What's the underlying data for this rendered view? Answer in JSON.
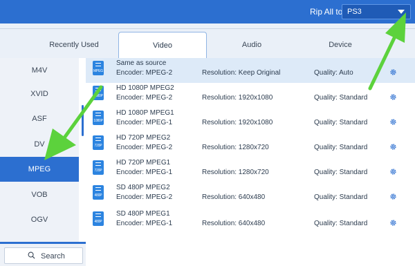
{
  "topbar": {
    "rip_label": "Rip All to:",
    "rip_value": "PS3"
  },
  "tabs": [
    {
      "label": "Recently Used",
      "active": false
    },
    {
      "label": "Video",
      "active": true
    },
    {
      "label": "Audio",
      "active": false
    },
    {
      "label": "Device",
      "active": false
    }
  ],
  "sidebar": {
    "items": [
      {
        "label": "M4V",
        "active": false
      },
      {
        "label": "XVID",
        "active": false
      },
      {
        "label": "ASF",
        "active": false
      },
      {
        "label": "DV",
        "active": false
      },
      {
        "label": "MPEG",
        "active": true
      },
      {
        "label": "VOB",
        "active": false
      },
      {
        "label": "OGV",
        "active": false
      }
    ],
    "search_label": "Search"
  },
  "formats": [
    {
      "tag": "MPEG",
      "name": "Same as source",
      "encoder": "Encoder: MPEG-2",
      "resolution": "Resolution: Keep Original",
      "quality": "Quality: Auto",
      "selected": true
    },
    {
      "tag": "1080P",
      "name": "HD 1080P MPEG2",
      "encoder": "Encoder: MPEG-2",
      "resolution": "Resolution: 1920x1080",
      "quality": "Quality: Standard",
      "selected": false
    },
    {
      "tag": "1080P",
      "name": "HD 1080P MPEG1",
      "encoder": "Encoder: MPEG-1",
      "resolution": "Resolution: 1920x1080",
      "quality": "Quality: Standard",
      "selected": false
    },
    {
      "tag": "720P",
      "name": "HD 720P MPEG2",
      "encoder": "Encoder: MPEG-2",
      "resolution": "Resolution: 1280x720",
      "quality": "Quality: Standard",
      "selected": false
    },
    {
      "tag": "720P",
      "name": "HD 720P MPEG1",
      "encoder": "Encoder: MPEG-1",
      "resolution": "Resolution: 1280x720",
      "quality": "Quality: Standard",
      "selected": false
    },
    {
      "tag": "480P",
      "name": "SD 480P MPEG2",
      "encoder": "Encoder: MPEG-2",
      "resolution": "Resolution: 640x480",
      "quality": "Quality: Standard",
      "selected": false
    },
    {
      "tag": "480P",
      "name": "SD 480P MPEG1",
      "encoder": "Encoder: MPEG-1",
      "resolution": "Resolution: 640x480",
      "quality": "Quality: Standard",
      "selected": false
    }
  ],
  "icons": {
    "format": "video-file-icon",
    "settings": "gear-icon",
    "search": "search-icon",
    "dropdown": "chevron-down-icon",
    "annotation": "green-arrow"
  },
  "colors": {
    "accent": "#2c6fd0",
    "arrow": "#5cd23c"
  }
}
